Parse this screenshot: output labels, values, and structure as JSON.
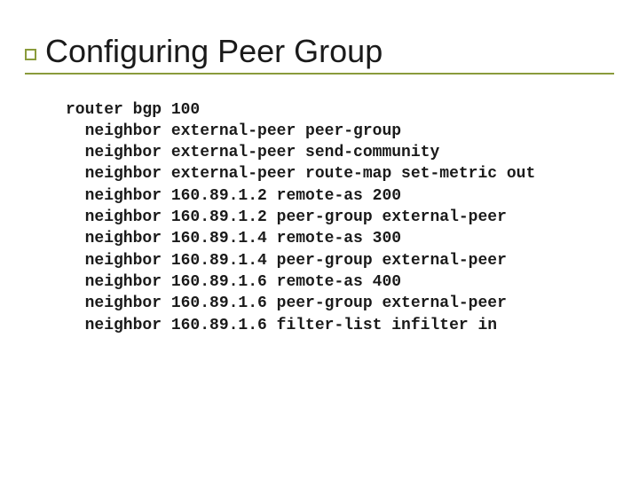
{
  "title": "Configuring Peer Group",
  "code": "router bgp 100\n  neighbor external-peer peer-group\n  neighbor external-peer send-community\n  neighbor external-peer route-map set-metric out\n  neighbor 160.89.1.2 remote-as 200\n  neighbor 160.89.1.2 peer-group external-peer\n  neighbor 160.89.1.4 remote-as 300\n  neighbor 160.89.1.4 peer-group external-peer\n  neighbor 160.89.1.6 remote-as 400\n  neighbor 160.89.1.6 peer-group external-peer\n  neighbor 160.89.1.6 filter-list infilter in"
}
